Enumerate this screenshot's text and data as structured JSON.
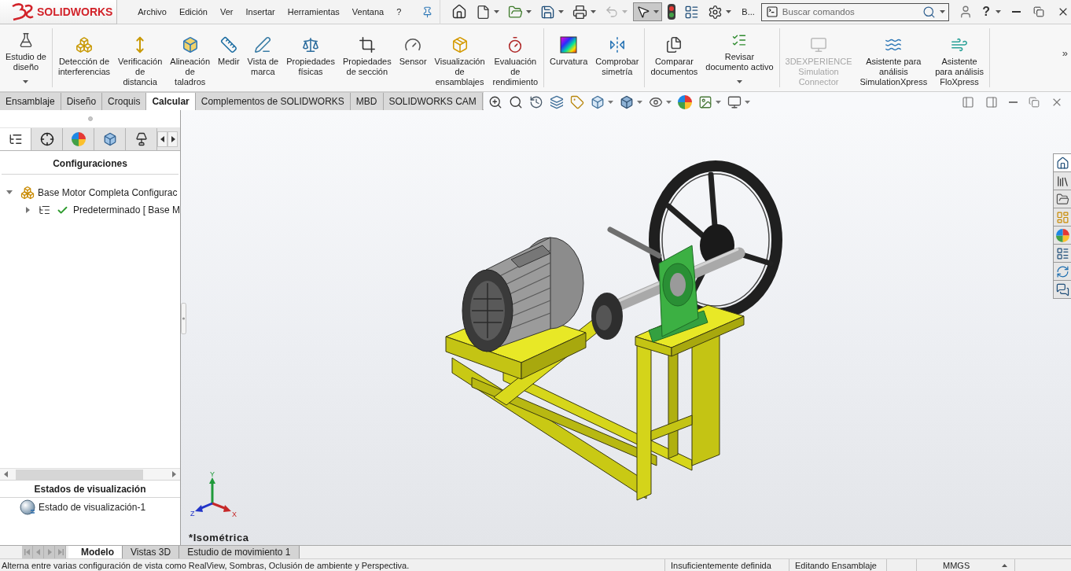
{
  "logo": {
    "wordmark": "SOLIDWORKS"
  },
  "menu": [
    "Archivo",
    "Edición",
    "Ver",
    "Insertar",
    "Herramientas",
    "Ventana",
    "?"
  ],
  "quick_access": [
    {
      "kind": "home",
      "dropdown": false,
      "disabled": false,
      "pressed": false
    },
    {
      "kind": "new",
      "dropdown": true,
      "disabled": false,
      "pressed": false
    },
    {
      "kind": "open",
      "dropdown": true,
      "disabled": false,
      "pressed": false
    },
    {
      "kind": "save",
      "dropdown": true,
      "disabled": false,
      "pressed": false
    },
    {
      "kind": "print",
      "dropdown": true,
      "disabled": false,
      "pressed": false
    },
    {
      "kind": "undo",
      "dropdown": true,
      "disabled": true,
      "pressed": false
    },
    {
      "kind": "select",
      "dropdown": true,
      "disabled": false,
      "pressed": true
    },
    {
      "kind": "rebuild",
      "dropdown": false,
      "disabled": false,
      "pressed": false
    },
    {
      "kind": "file_properties",
      "dropdown": false,
      "disabled": false,
      "pressed": false
    },
    {
      "kind": "options",
      "dropdown": true,
      "disabled": false,
      "pressed": false
    }
  ],
  "quick_access_overflow": "B...",
  "search": {
    "placeholder": "Buscar comandos"
  },
  "help_button": "?",
  "ribbon": {
    "groups": [
      [
        {
          "kind": "design_study",
          "label": "Estudio de\ndiseño",
          "dropdown": true,
          "disabled": false
        }
      ],
      [
        {
          "kind": "interference",
          "label": "Detección de\ninterferencias",
          "dropdown": false,
          "disabled": false
        },
        {
          "kind": "clearance",
          "label": "Verificación\nde\ndistancia",
          "dropdown": false,
          "disabled": false
        },
        {
          "kind": "hole_alignment",
          "label": "Alineación\nde\ntaladros",
          "dropdown": false,
          "disabled": false
        },
        {
          "kind": "measure",
          "label": "Medir",
          "dropdown": false,
          "disabled": false
        },
        {
          "kind": "markup",
          "label": "Vista de\nmarca",
          "dropdown": false,
          "disabled": false
        },
        {
          "kind": "mass_properties",
          "label": "Propiedades\nfísicas",
          "dropdown": false,
          "disabled": false
        },
        {
          "kind": "section_properties",
          "label": "Propiedades\nde sección",
          "dropdown": false,
          "disabled": false
        },
        {
          "kind": "sensor",
          "label": "Sensor",
          "dropdown": false,
          "disabled": false
        },
        {
          "kind": "assembly_visualization",
          "label": "Visualización\nde\nensamblajes",
          "dropdown": false,
          "disabled": false
        },
        {
          "kind": "performance",
          "label": "Evaluación\nde\nrendimiento",
          "dropdown": false,
          "disabled": false
        }
      ],
      [
        {
          "kind": "curvature",
          "label": "Curvatura",
          "dropdown": false,
          "disabled": false
        },
        {
          "kind": "symmetry",
          "label": "Comprobar\nsimetría",
          "dropdown": false,
          "disabled": false
        }
      ],
      [
        {
          "kind": "compare",
          "label": "Comparar\ndocumentos",
          "dropdown": false,
          "disabled": false
        },
        {
          "kind": "check_document",
          "label": "Revisar\ndocumento activo",
          "dropdown": true,
          "disabled": false
        }
      ],
      [
        {
          "kind": "connector",
          "label": "3DEXPERIENCE\nSimulation\nConnector",
          "dropdown": false,
          "disabled": true
        },
        {
          "kind": "simulation_xpress",
          "label": "Asistente para\nanálisis\nSimulationXpress",
          "dropdown": false,
          "disabled": false
        },
        {
          "kind": "flo_xpress",
          "label": "Asistente\npara análisis\nFloXpress",
          "dropdown": false,
          "disabled": false
        }
      ]
    ],
    "more": "»"
  },
  "command_tabs": [
    {
      "label": "Ensamblaje",
      "selected": false
    },
    {
      "label": "Diseño",
      "selected": false
    },
    {
      "label": "Croquis",
      "selected": false
    },
    {
      "label": "Calcular",
      "selected": true
    },
    {
      "label": "Complementos de SOLIDWORKS",
      "selected": false
    },
    {
      "label": "MBD",
      "selected": false
    },
    {
      "label": "SOLIDWORKS CAM",
      "selected": false
    }
  ],
  "view_toolbar": [
    {
      "kind": "zoom_fit",
      "dropdown": false
    },
    {
      "kind": "zoom_area",
      "dropdown": false
    },
    {
      "kind": "previous_view",
      "dropdown": false
    },
    {
      "kind": "section_view",
      "dropdown": false
    },
    {
      "kind": "dynamic_annotation",
      "dropdown": false
    },
    {
      "kind": "view_orientation",
      "dropdown": true
    },
    {
      "kind": "display_style",
      "dropdown": true
    },
    {
      "kind": "hide_show",
      "dropdown": true
    },
    {
      "kind": "edit_appearance",
      "dropdown": false
    },
    {
      "kind": "apply_scene",
      "dropdown": true
    },
    {
      "kind": "view_settings",
      "dropdown": true
    }
  ],
  "left_panel": {
    "tabs": [
      {
        "kind": "feature_tree",
        "selected": true
      },
      {
        "kind": "property",
        "selected": false
      },
      {
        "kind": "configuration",
        "selected": false
      },
      {
        "kind": "dimxpert",
        "selected": false
      },
      {
        "kind": "display",
        "selected": false
      }
    ],
    "config_header": "Configuraciones",
    "tree": [
      {
        "label": "Base Motor Completa Configurac",
        "expanded": true,
        "active": false,
        "children": [
          {
            "label": "Predeterminado [ Base M",
            "expanded": false,
            "active": true
          }
        ]
      }
    ],
    "display_header": "Estados de visualización",
    "display_states": [
      {
        "label": "Estado de visualización-1"
      }
    ]
  },
  "viewport": {
    "view_name": "*Isométrica",
    "triad": {
      "x": "X",
      "y": "Y",
      "z": "Z"
    }
  },
  "task_pane": [
    {
      "kind": "home",
      "selected": true
    },
    {
      "kind": "design_library",
      "selected": false
    },
    {
      "kind": "file_explorer",
      "selected": false
    },
    {
      "kind": "view_palette",
      "selected": false
    },
    {
      "kind": "appearances",
      "selected": false
    },
    {
      "kind": "custom_properties",
      "selected": false
    },
    {
      "kind": "resources",
      "selected": false
    },
    {
      "kind": "forum",
      "selected": false
    }
  ],
  "bottom_tabs": {
    "nav_disabled": true,
    "tabs": [
      {
        "label": "Modelo",
        "selected": true
      },
      {
        "label": "Vistas 3D",
        "selected": false
      },
      {
        "label": "Estudio de movimiento 1",
        "selected": false
      }
    ]
  },
  "status_bar": {
    "message": "Alterna entre varias configuración de vista como RealView, Sombras, Oclusión de ambiente y Perspectiva.",
    "fields": [
      "Insuficientemente definida",
      "Editando Ensamblaje"
    ],
    "units": "MMGS"
  }
}
